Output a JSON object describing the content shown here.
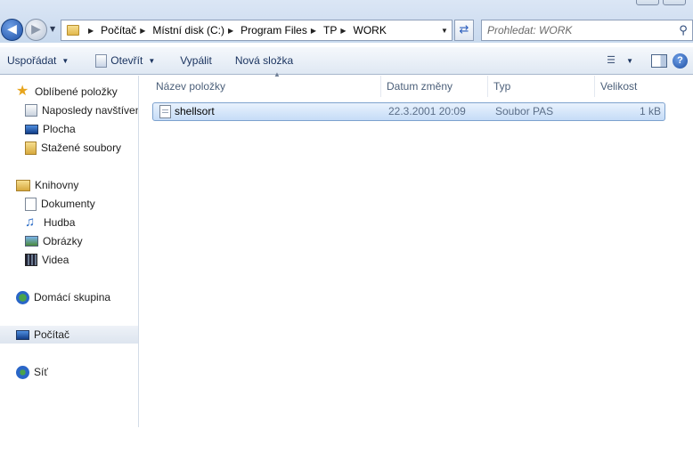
{
  "address": {
    "crumbs": [
      "Počítač",
      "Místní disk (C:)",
      "Program Files",
      "TP",
      "WORK"
    ]
  },
  "search": {
    "placeholder": "Prohledat: WORK"
  },
  "toolbar": {
    "organize_label": "Uspořádat",
    "open_label": "Otevřít",
    "burn_label": "Vypálit",
    "new_folder_label": "Nová složka"
  },
  "sidebar": {
    "items": [
      {
        "label": "Oblíbené položky",
        "icon": "star-icon"
      },
      {
        "label": "Naposledy navštívené",
        "icon": "recent-places-icon"
      },
      {
        "label": "Plocha",
        "icon": "desktop-icon"
      },
      {
        "label": "Stažené soubory",
        "icon": "downloads-icon"
      },
      {
        "label": "Knihovny",
        "icon": "libraries-icon"
      },
      {
        "label": "Dokumenty",
        "icon": "documents-icon"
      },
      {
        "label": "Hudba",
        "icon": "music-icon"
      },
      {
        "label": "Obrázky",
        "icon": "pictures-icon"
      },
      {
        "label": "Videa",
        "icon": "videos-icon"
      },
      {
        "label": "Domácí skupina",
        "icon": "homegroup-icon"
      },
      {
        "label": "Počítač",
        "icon": "computer-icon"
      },
      {
        "label": "Síť",
        "icon": "network-icon"
      }
    ]
  },
  "columns": {
    "name": "Název položky",
    "date": "Datum změny",
    "type": "Typ",
    "size": "Velikost"
  },
  "files": [
    {
      "name": "shellsort",
      "date": "22.3.2001 20:09",
      "type": "Soubor PAS",
      "size": "1 kB"
    }
  ],
  "colors": {
    "selection": "#c5dcf7",
    "selection_border": "#7da2ce",
    "toolbar_text": "#1b3460"
  }
}
